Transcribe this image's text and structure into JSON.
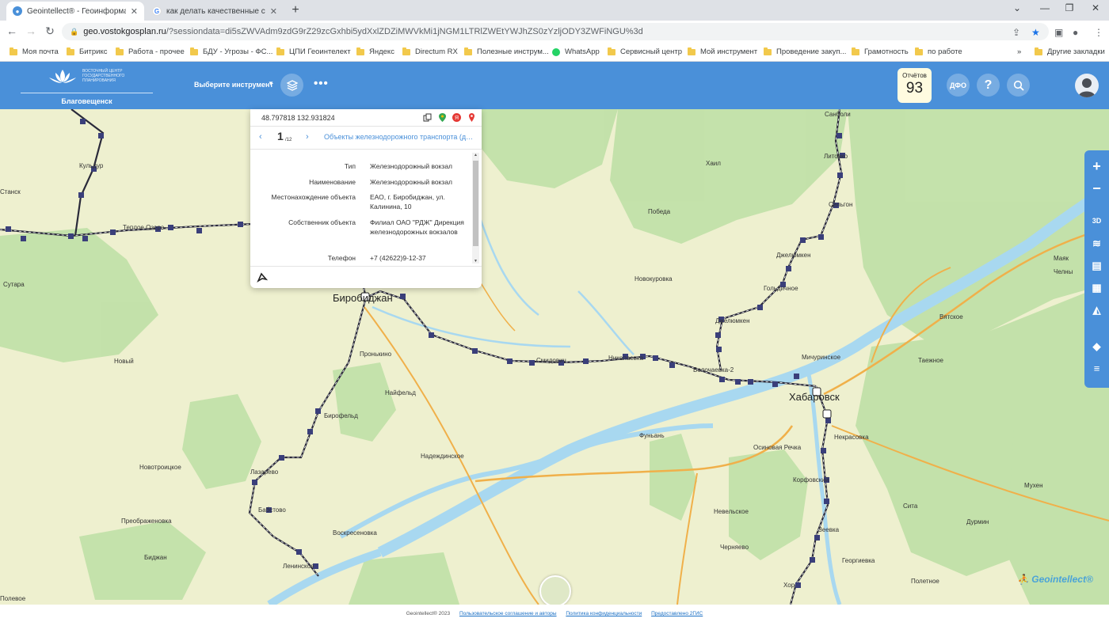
{
  "browser": {
    "tabs": [
      {
        "title": "Geointellect® - Геоинформационн",
        "active": true
      },
      {
        "title": "как делать качественные снимки",
        "active": false
      }
    ],
    "url_main": "geo.vostokgosplan.ru",
    "url_rest": "/?sessiondata=di5sZWVAdm9zdG9rZ29zcGxhbi5ydXxlZDZiMWVkMi1jNGM1LTRlZWEtYWJhZS0zYzljODY3ZWFiNGU%3d",
    "bookmarks": [
      "Моя почта",
      "Битрикс",
      "Работа - прочее",
      "БДУ - Угрозы - ФС...",
      "ЦПИ Геоинтелект",
      "Яндекс",
      "Directum RX",
      "Полезные инструм...",
      "WhatsApp",
      "Сервисный центр",
      "Мой инструмент",
      "Проведение закуп...",
      "Грамотность",
      "по работе"
    ],
    "other_bookmarks": "Другие закладки"
  },
  "header": {
    "logo_text": "ВОСТОЧНЫЙ ЦЕНТР ГОСУДАРСТВЕННОГО ПЛАНИРОВАНИЯ",
    "city": "Благовещенск",
    "tool_select": "Выберите инструмент",
    "reports_label": "Отчётов",
    "reports_count": "93",
    "dfo_label": "ДФО",
    "help_label": "?"
  },
  "popup": {
    "coords": "48.797818 132.931824",
    "page_current": "1",
    "page_total": "/12",
    "layer_name": "Объекты железнодорожного транспорта (данные...",
    "fields": [
      {
        "label": "Тип",
        "value": "Железнодорожный вокзал"
      },
      {
        "label": "Наименование",
        "value": "Железнодорожный вокзал"
      },
      {
        "label": "Местонахождение объекта",
        "value": "ЕАО, г. Биробиджан, ул. Калинина, 10"
      },
      {
        "label": "Собственник объекта",
        "value": "Филиал ОАО \"РДЖ\" Дирекция железнодорожных вокзалов"
      },
      {
        "label": "Телефон",
        "value": "+7 (42622)9-12-37"
      }
    ]
  },
  "map": {
    "places": [
      {
        "name": "Биробиджан",
        "big": true
      },
      {
        "name": "Хабаровск",
        "big": true
      },
      {
        "name": "Кульдур"
      },
      {
        "name": "Теплое Озеро"
      },
      {
        "name": "Сутара"
      },
      {
        "name": "Новый"
      },
      {
        "name": "Пронькино"
      },
      {
        "name": "Найфельд"
      },
      {
        "name": "Бирофельд"
      },
      {
        "name": "Надеждинское"
      },
      {
        "name": "Новотроицкое"
      },
      {
        "name": "Лазарево"
      },
      {
        "name": "Бабстово"
      },
      {
        "name": "Преображеновка"
      },
      {
        "name": "Воскресеновка"
      },
      {
        "name": "Ленинское"
      },
      {
        "name": "Биджан"
      },
      {
        "name": "Полевое"
      },
      {
        "name": "Победа"
      },
      {
        "name": "Новокуровка"
      },
      {
        "name": "Хаил"
      },
      {
        "name": "Джелюмкен"
      },
      {
        "name": "Гольдичное"
      },
      {
        "name": "Джелюмкен"
      },
      {
        "name": "Мичуринское"
      },
      {
        "name": "Волочаевка-2"
      },
      {
        "name": "Смидович"
      },
      {
        "name": "Николаевка"
      },
      {
        "name": "Фуньань"
      },
      {
        "name": "Осиновая Речка"
      },
      {
        "name": "Некрасовка"
      },
      {
        "name": "Корфовский"
      },
      {
        "name": "Невельское"
      },
      {
        "name": "Черняево"
      },
      {
        "name": "Георгиевка"
      },
      {
        "name": "Полетное"
      },
      {
        "name": "Дурмин"
      },
      {
        "name": "Сита"
      },
      {
        "name": "Мухен"
      },
      {
        "name": "Таежное"
      },
      {
        "name": "Вятское"
      },
      {
        "name": "Маяк"
      },
      {
        "name": "Челны"
      },
      {
        "name": "Литовко"
      },
      {
        "name": "Санболи"
      },
      {
        "name": "Сельгон"
      },
      {
        "name": "Хор"
      },
      {
        "name": "Зеевка"
      },
      {
        "name": "Станск"
      }
    ]
  },
  "footer": {
    "copyright": "Geointellect® 2023",
    "agreement": "Пользовательское соглашение и авторы",
    "privacy": "Политика конфиденциальности",
    "provider": "Предоставлено 2ГИС",
    "watermark": "Geointellect"
  },
  "rightbar": {
    "zoom_in": "+",
    "zoom_out": "−",
    "mode_3d": "3D"
  },
  "colors": {
    "header": "#4a90d9",
    "accent": "#4a90d9",
    "river": "#a8d8f0",
    "forest": "#bfe0a6",
    "road": "#f0b04a"
  }
}
